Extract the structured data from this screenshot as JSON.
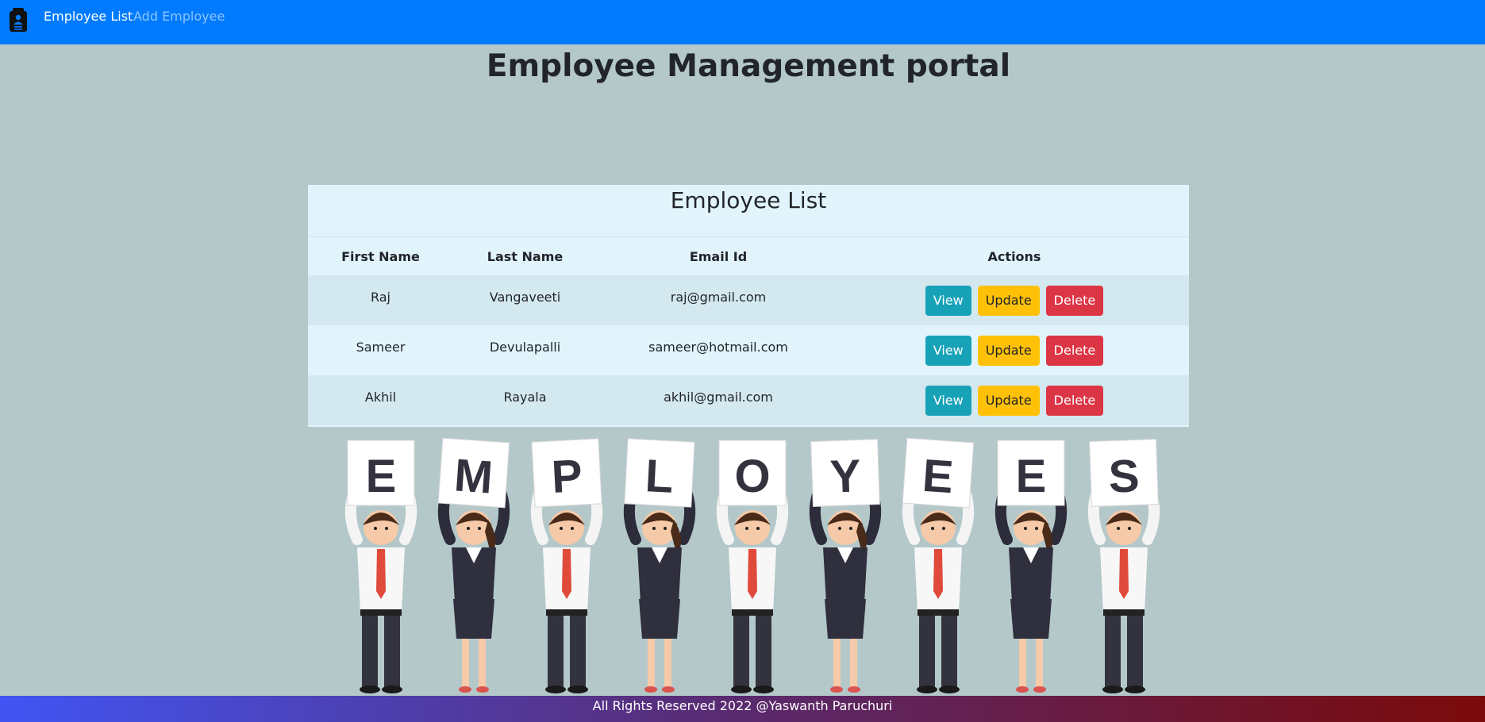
{
  "nav": {
    "brand_icon": "badge-icon",
    "links": [
      {
        "label": "Employee List",
        "active": true
      },
      {
        "label": "Add Employee",
        "active": false
      }
    ]
  },
  "page_title": "Employee Management portal",
  "card": {
    "title": "Employee List",
    "columns": [
      "First Name",
      "Last Name",
      "Email Id",
      "Actions"
    ],
    "rows": [
      {
        "first_name": "Raj",
        "last_name": "Vangaveeti",
        "email": "raj@gmail.com"
      },
      {
        "first_name": "Sameer",
        "last_name": "Devulapalli",
        "email": "sameer@hotmail.com"
      },
      {
        "first_name": "Akhil",
        "last_name": "Rayala",
        "email": "akhil@gmail.com"
      }
    ],
    "actions": {
      "view": "View",
      "update": "Update",
      "delete": "Delete"
    }
  },
  "illustration": {
    "letters": [
      "E",
      "M",
      "P",
      "L",
      "O",
      "Y",
      "E",
      "E",
      "S"
    ]
  },
  "footer": "All Rights Reserved 2022 @Yaswanth Paruchuri",
  "colors": {
    "navbar": "#007bff",
    "background": "#b4c8ca",
    "view_button": "#17a2b8",
    "update_button": "#ffc107",
    "delete_button": "#dc3545"
  }
}
